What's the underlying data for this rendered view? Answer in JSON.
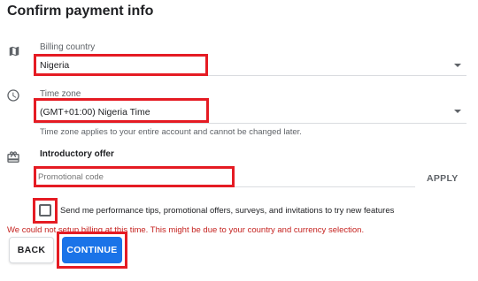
{
  "header": {
    "title": "Confirm payment info"
  },
  "billing": {
    "label": "Billing country",
    "value": "Nigeria",
    "icon": "map-icon"
  },
  "timezone": {
    "label": "Time zone",
    "value": "(GMT+01:00) Nigeria Time",
    "hint": "Time zone applies to your entire account and cannot be changed later.",
    "icon": "clock-icon"
  },
  "promo": {
    "section_label": "Introductory offer",
    "placeholder": "Promotional code",
    "apply_label": "APPLY",
    "icon": "gift-icon"
  },
  "consent": {
    "label": "Send me performance tips, promotional offers, surveys, and invitations to try new features",
    "checked": false
  },
  "error": {
    "message": "We could not setup billing at this time. This might be due to your country and currency selection."
  },
  "actions": {
    "back_label": "BACK",
    "continue_label": "CONTINUE"
  },
  "colors": {
    "accent": "#1a73e8",
    "error": "#c5221f",
    "highlight": "#e51b23"
  }
}
